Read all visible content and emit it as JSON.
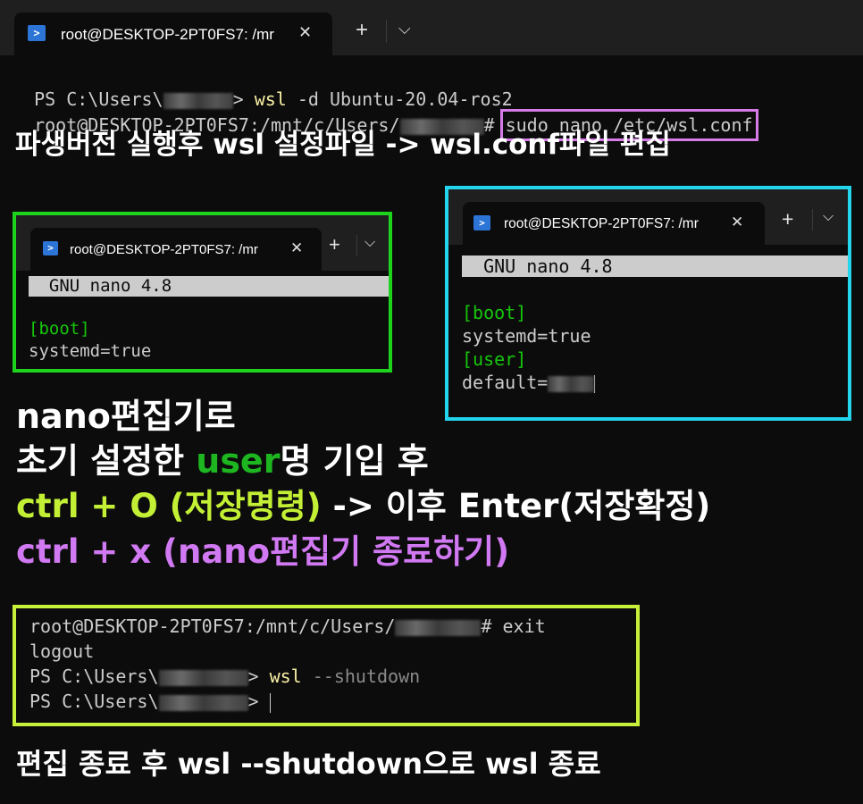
{
  "main_window": {
    "tab_title": "root@DESKTOP-2PT0FS7: /mr",
    "new_tab": "+",
    "dropdown": "⌵",
    "close": "✕",
    "line1": {
      "prompt_a": "PS C:\\Users\\",
      "prompt_b": "> ",
      "cmd": "wsl",
      "args": " -d Ubuntu-20.04-ros2"
    },
    "line2": {
      "prompt_a": "root@DESKTOP-2PT0FS7:/mnt/c/Users/",
      "prompt_b": "# ",
      "cmd": "sudo nano /etc/wsl.conf"
    }
  },
  "captions": {
    "step1": "파생버전 실행후 wsl 설정파일 -> wsl.conf파일 편집",
    "step2_l1": "nano편집기로",
    "step2_l2_a": "초기 설정한 ",
    "step2_l2_b": "user",
    "step2_l2_c": "명 기입 후",
    "step2_l3_a": "ctrl + O (저장명령)",
    "step2_l3_b": " -> 이후 Enter(저장확정)",
    "step2_l4": "ctrl + x (nano편집기 종료하기)",
    "step3": "편집 종료 후 wsl --shutdown으로 wsl 종료"
  },
  "nano_left": {
    "tab_title": "root@DESKTOP-2PT0FS7: /mr",
    "header": "  GNU nano 4.8",
    "section": "[boot]",
    "setting": "systemd=true"
  },
  "nano_right": {
    "tab_title": "root@DESKTOP-2PT0FS7: /mr",
    "header": "  GNU nano 4.8",
    "section1": "[boot]",
    "setting1": "systemd=true",
    "section2": "[user]",
    "setting2": "default="
  },
  "shutdown_term": {
    "l1_a": "root@DESKTOP-2PT0FS7:/mnt/c/Users/",
    "l1_b": "# exit",
    "l2": "logout",
    "l3_a": "PS C:\\Users\\",
    "l3_b": "> ",
    "l3_cmd": "wsl",
    "l3_args": " --shutdown",
    "l4_a": "PS C:\\Users\\",
    "l4_b": "> "
  },
  "colors": {
    "frame_green": "#1ed31e",
    "frame_cyan": "#22d4ec",
    "frame_lime": "#c6f03a",
    "highlight_violet": "#d77be8",
    "ps_icon_blue": "#2c74d6"
  },
  "icons": [
    "powershell-icon",
    "close-icon",
    "plus-icon",
    "chevron-down-icon"
  ]
}
